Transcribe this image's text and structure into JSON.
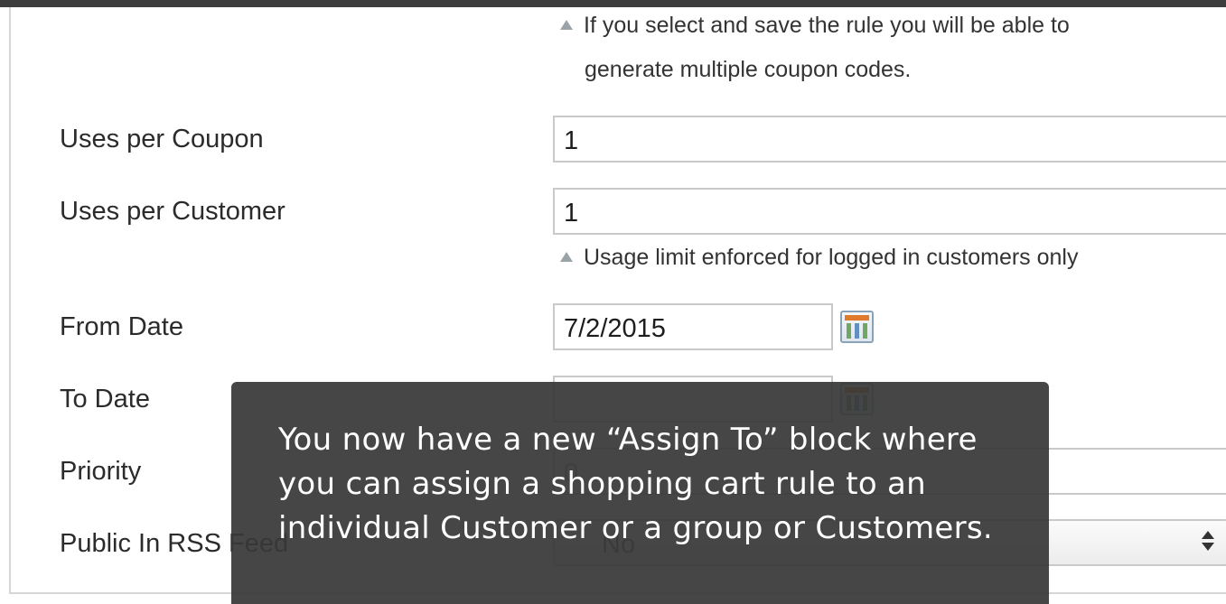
{
  "coupon_hint": {
    "line1": "If you select and save the rule you will be able to",
    "line2": "generate multiple coupon codes."
  },
  "fields": {
    "uses_per_coupon": {
      "label": "Uses per Coupon",
      "value": "1"
    },
    "uses_per_customer": {
      "label": "Uses per Customer",
      "value": "1",
      "hint": "Usage limit enforced for logged in customers only"
    },
    "from_date": {
      "label": "From Date",
      "value": "7/2/2015"
    },
    "to_date": {
      "label": "To Date",
      "value": ""
    },
    "priority": {
      "label": "Priority",
      "value": "0"
    },
    "public_in_rss": {
      "label": "Public In RSS Feed",
      "value": "No"
    }
  },
  "overlay": {
    "text": "You now have a new “Assign To” block where you can assign a shopping cart rule to an individual Customer or a group or Customers."
  },
  "icons": {
    "calendar": "calendar-icon",
    "hint": "triangle-up-icon",
    "select": "select-arrows-icon"
  },
  "colors": {
    "overlay_bg": "#383838",
    "calendar_header": "#e07a2d"
  }
}
